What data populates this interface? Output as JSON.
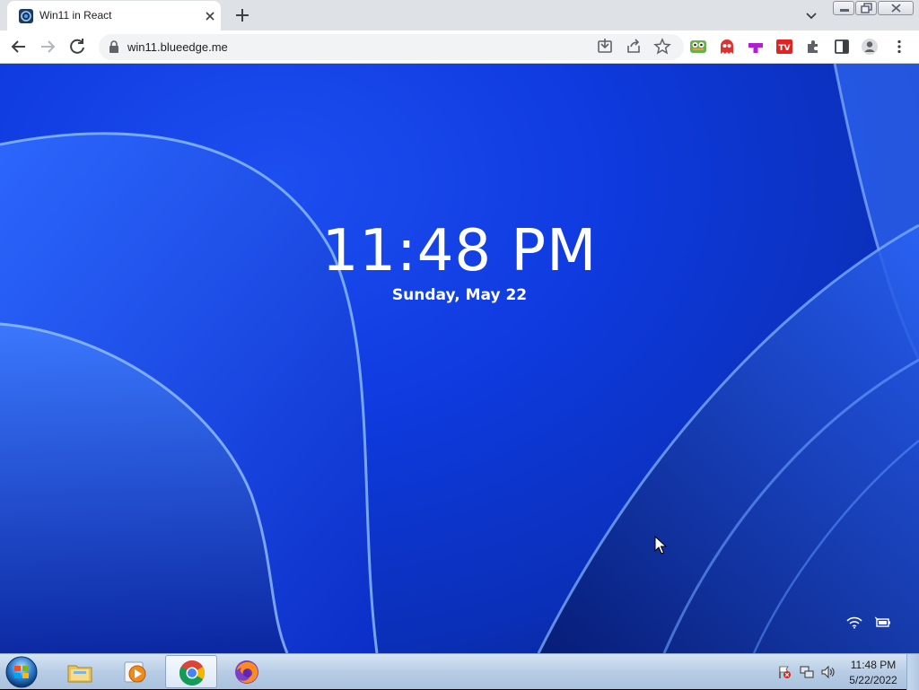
{
  "browser": {
    "tab": {
      "title": "Win11 in React",
      "favicon": "win11-icon"
    },
    "address": {
      "url": "win11.blueedge.me"
    },
    "toolbar_icons": [
      "back-arrow-icon",
      "forward-arrow-icon",
      "reload-icon",
      "lock-icon",
      "install-app-icon",
      "share-icon",
      "bookmark-star-icon"
    ],
    "extensions": [
      "frog-extension-icon",
      "ghost-extension-icon",
      "tetris-extension-icon",
      "tv-extension-icon",
      "puzzle-extensions-icon",
      "side-panel-icon",
      "profile-icon",
      "menu-kebab-icon"
    ]
  },
  "lockscreen": {
    "time": "11:48 PM",
    "date": "Sunday, May 22",
    "status_icons": [
      "wifi-icon",
      "battery-icon"
    ]
  },
  "taskbar": {
    "apps": [
      "file-explorer-icon",
      "media-player-icon",
      "chrome-icon",
      "firefox-icon"
    ],
    "active_app": "chrome",
    "tray_icons": [
      "action-center-flag-icon",
      "network-icon",
      "volume-icon"
    ],
    "clock": {
      "time": "11:48 PM",
      "date": "5/22/2022"
    }
  },
  "colors": {
    "wallpaper_base": "#0f3be0",
    "wallpaper_light": "#4f8dff",
    "chrome_tabstrip": "#dee1e6",
    "taskbar": "#b8cde5"
  }
}
